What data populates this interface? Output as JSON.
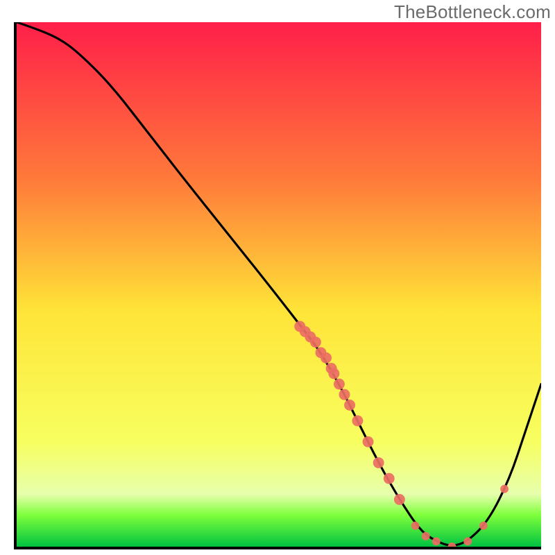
{
  "watermark": "TheBottleneck.com",
  "colors": {
    "top": "#ff1f49",
    "mid": "#ffe438",
    "green_band": "#7dff3b",
    "bottom": "#00c241",
    "axis": "#000000",
    "curve": "#000000",
    "marker": "#ec6e63"
  },
  "chart_data": {
    "type": "line",
    "title": "",
    "xlabel": "",
    "ylabel": "",
    "xlim": [
      0,
      100
    ],
    "ylim": [
      0,
      100
    ],
    "grid": false,
    "legend": false,
    "series": [
      {
        "name": "bottleneck-curve",
        "x": [
          0,
          3,
          8,
          12,
          18,
          25,
          32,
          40,
          48,
          55,
          58,
          62,
          65,
          69,
          73,
          77,
          80,
          83,
          86,
          90,
          94,
          97,
          100
        ],
        "y": [
          100,
          99,
          97,
          94,
          88,
          79,
          70,
          60,
          50,
          41,
          37,
          30,
          24,
          16,
          9,
          3,
          1,
          0,
          1,
          5,
          13,
          22,
          31
        ]
      }
    ],
    "markers": {
      "name": "highlight-points",
      "x": [
        54,
        55,
        56,
        57,
        58,
        59,
        60,
        60.5,
        61.5,
        62.5,
        63.5,
        65,
        67,
        69,
        71,
        73,
        76,
        78,
        80,
        83,
        86,
        89,
        93
      ],
      "y": [
        42,
        41,
        40,
        39,
        37,
        36,
        34,
        33,
        31,
        29,
        27,
        24,
        20,
        16,
        13,
        9,
        4,
        2,
        1,
        0,
        1,
        4,
        11
      ]
    }
  }
}
